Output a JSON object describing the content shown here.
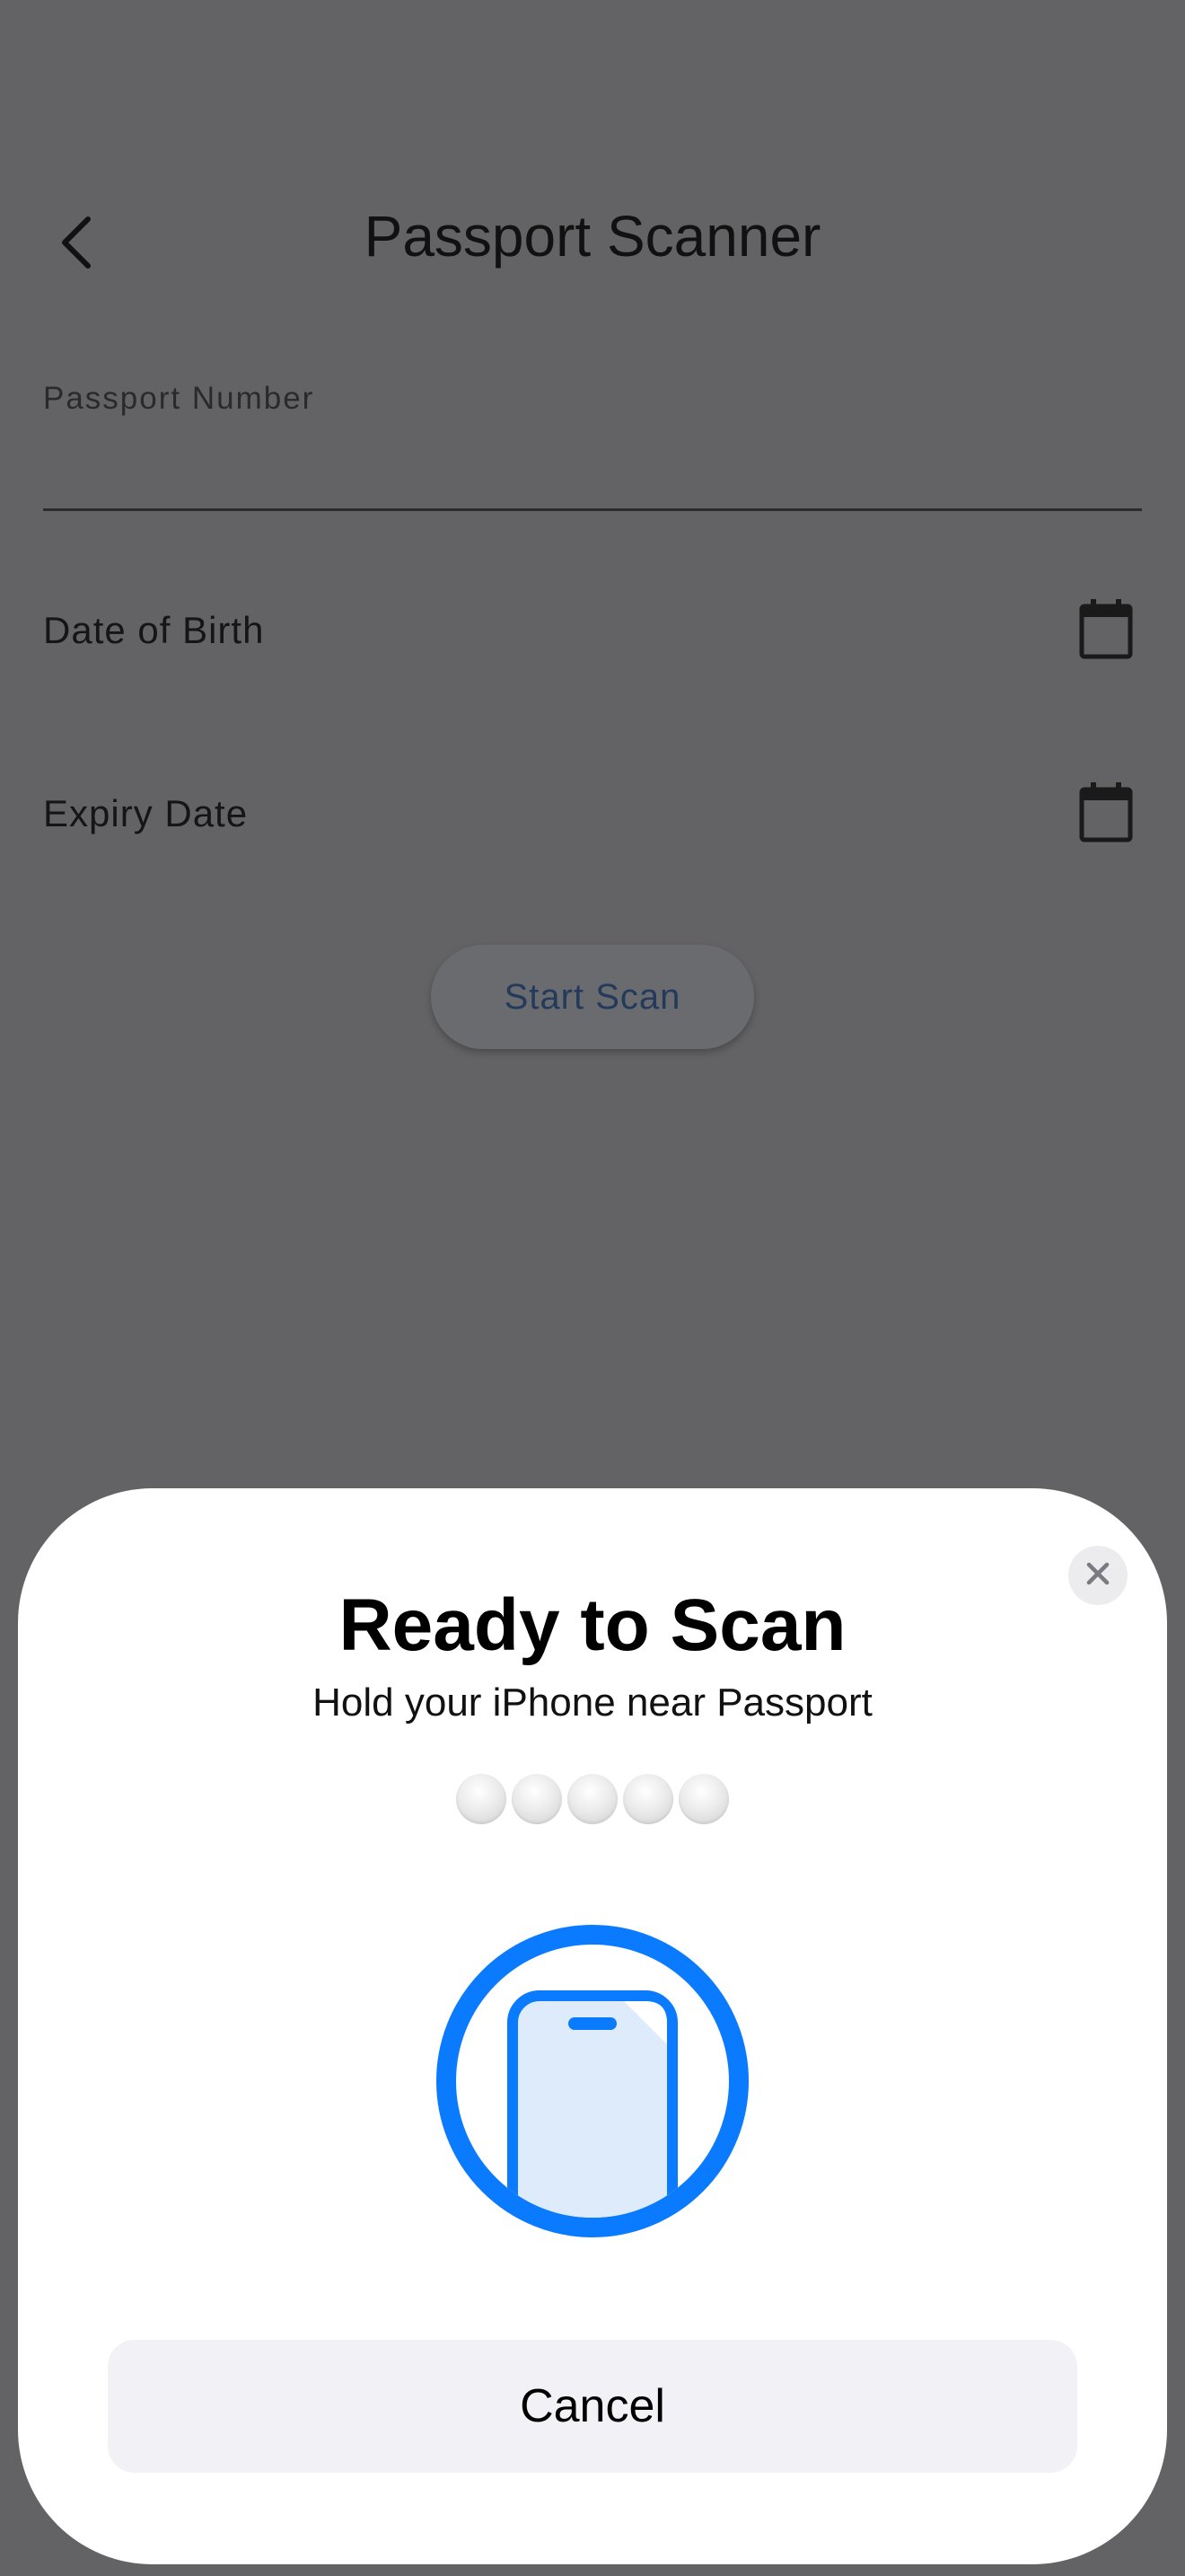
{
  "app": {
    "title": "Passport Scanner"
  },
  "form": {
    "passport_label": "Passport Number",
    "passport_value": "",
    "dob_label": "Date of Birth",
    "expiry_label": "Expiry Date",
    "start_button": "Start Scan"
  },
  "sheet": {
    "title": "Ready to Scan",
    "subtitle": "Hold your iPhone near Passport",
    "progress_dots": 5,
    "cancel_label": "Cancel"
  },
  "icons": {
    "back": "chevron-left-icon",
    "calendar": "calendar-icon",
    "close": "close-icon",
    "nfc": "phone-nfc-icon"
  },
  "colors": {
    "accent": "#0A7AFF",
    "overlay": "#636365",
    "sheet": "#FFFFFF",
    "cancel_bg": "#F2F2F6"
  }
}
